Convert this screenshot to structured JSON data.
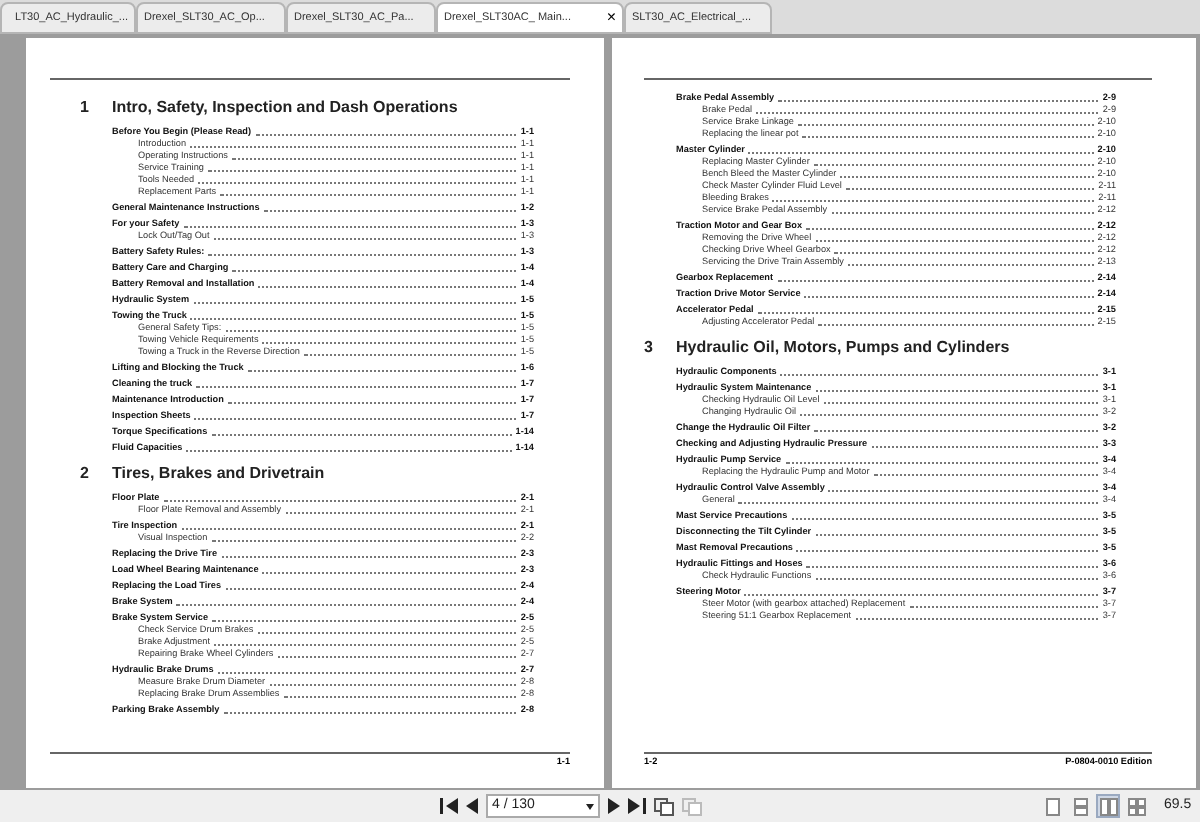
{
  "tabs": [
    {
      "label": "LT30_AC_Hydraulic_...",
      "selected": false
    },
    {
      "label": "Drexel_SLT30_AC_Op...",
      "selected": false
    },
    {
      "label": "Drexel_SLT30_AC_Pa...",
      "selected": false
    },
    {
      "label": "Drexel_SLT30AC_ Main...",
      "selected": true,
      "close": "×"
    },
    {
      "label": "SLT30_AC_Electrical_...",
      "selected": false
    }
  ],
  "pages": [
    {
      "footer_right": "1-1",
      "entries": [
        {
          "kind": "chapter",
          "number": "1",
          "title": "Intro, Safety, Inspection and Dash Operations"
        },
        {
          "kind": "section",
          "title": "Before You Begin (Please Read)",
          "page": "1-1",
          "children": [
            {
              "title": "Introduction",
              "page": "1-1"
            },
            {
              "title": "Operating Instructions",
              "page": "1-1"
            },
            {
              "title": "Service Training",
              "page": "1-1"
            },
            {
              "title": "Tools Needed",
              "page": "1-1"
            },
            {
              "title": "Replacement Parts",
              "page": "1-1"
            }
          ]
        },
        {
          "kind": "section",
          "title": "General Maintenance Instructions",
          "page": "1-2"
        },
        {
          "kind": "section",
          "title": "For your Safety",
          "page": "1-3",
          "children": [
            {
              "title": "Lock Out/Tag Out",
              "page": "1-3"
            }
          ]
        },
        {
          "kind": "section",
          "title": "Battery Safety Rules:",
          "page": "1-3"
        },
        {
          "kind": "section",
          "title": "Battery Care and Charging",
          "page": "1-4"
        },
        {
          "kind": "section",
          "title": "Battery Removal and Installation",
          "page": "1-4"
        },
        {
          "kind": "section",
          "title": "Hydraulic System",
          "page": "1-5"
        },
        {
          "kind": "section",
          "title": "Towing the Truck",
          "page": "1-5",
          "children": [
            {
              "title": "General Safety Tips:",
              "page": "1-5"
            },
            {
              "title": "Towing Vehicle Requirements",
              "page": "1-5"
            },
            {
              "title": "Towing a Truck in the Reverse Direction",
              "page": "1-5"
            }
          ]
        },
        {
          "kind": "section",
          "title": "Lifting and Blocking the Truck",
          "page": "1-6"
        },
        {
          "kind": "section",
          "title": "Cleaning the truck",
          "page": "1-7"
        },
        {
          "kind": "section",
          "title": "Maintenance Introduction",
          "page": "1-7"
        },
        {
          "kind": "section",
          "title": "Inspection Sheets",
          "page": "1-7"
        },
        {
          "kind": "section",
          "title": "Torque Specifications",
          "page": "1-14"
        },
        {
          "kind": "section",
          "title": "Fluid Capacities",
          "page": "1-14"
        },
        {
          "kind": "chapter",
          "number": "2",
          "title": "Tires, Brakes and Drivetrain"
        },
        {
          "kind": "section",
          "title": "Floor Plate",
          "page": "2-1",
          "children": [
            {
              "title": "Floor Plate Removal and Assembly",
              "page": "2-1"
            }
          ]
        },
        {
          "kind": "section",
          "title": "Tire Inspection",
          "page": "2-1",
          "children": [
            {
              "title": "Visual Inspection",
              "page": "2-2"
            }
          ]
        },
        {
          "kind": "section",
          "title": "Replacing the Drive Tire",
          "page": "2-3"
        },
        {
          "kind": "section",
          "title": "Load Wheel Bearing Maintenance",
          "page": "2-3"
        },
        {
          "kind": "section",
          "title": "Replacing the Load Tires",
          "page": "2-4"
        },
        {
          "kind": "section",
          "title": "Brake System",
          "page": "2-4"
        },
        {
          "kind": "section",
          "title": "Brake System Service",
          "page": "2-5",
          "children": [
            {
              "title": "Check Service Drum Brakes",
              "page": "2-5"
            },
            {
              "title": "Brake Adjustment",
              "page": "2-5"
            },
            {
              "title": "Repairing Brake Wheel Cylinders",
              "page": "2-7"
            }
          ]
        },
        {
          "kind": "section",
          "title": "Hydraulic Brake Drums",
          "page": "2-7",
          "children": [
            {
              "title": "Measure Brake Drum Diameter",
              "page": "2-8"
            },
            {
              "title": "Replacing Brake Drum Assemblies",
              "page": "2-8"
            }
          ]
        },
        {
          "kind": "section",
          "title": "Parking Brake Assembly",
          "page": "2-8"
        }
      ]
    },
    {
      "footer_left": "1-2",
      "footer_right": "P-0804-0010 Edition",
      "entries": [
        {
          "kind": "section",
          "title": "Brake Pedal Assembly",
          "page": "2-9",
          "children": [
            {
              "title": "Brake Pedal",
              "page": "2-9"
            },
            {
              "title": "Service Brake Linkage",
              "page": "2-10"
            },
            {
              "title": "Replacing the linear pot",
              "page": "2-10"
            }
          ]
        },
        {
          "kind": "section",
          "title": "Master Cylinder",
          "page": "2-10",
          "children": [
            {
              "title": "Replacing Master Cylinder",
              "page": "2-10"
            },
            {
              "title": "Bench Bleed the Master Cylinder",
              "page": "2-10"
            },
            {
              "title": "Check Master Cylinder Fluid Level",
              "page": "2-11"
            },
            {
              "title": "Bleeding Brakes",
              "page": "2-11"
            },
            {
              "title": "Service Brake Pedal Assembly",
              "page": "2-12"
            }
          ]
        },
        {
          "kind": "section",
          "title": "Traction Motor and Gear Box",
          "page": "2-12",
          "children": [
            {
              "title": "Removing the Drive Wheel",
              "page": "2-12"
            },
            {
              "title": "Checking Drive Wheel Gearbox",
              "page": "2-12"
            },
            {
              "title": "Servicing the Drive Train Assembly",
              "page": "2-13"
            }
          ]
        },
        {
          "kind": "section",
          "title": "Gearbox Replacement",
          "page": "2-14"
        },
        {
          "kind": "section",
          "title": "Traction Drive Motor Service",
          "page": "2-14"
        },
        {
          "kind": "section",
          "title": "Accelerator Pedal",
          "page": "2-15",
          "children": [
            {
              "title": "Adjusting Accelerator Pedal",
              "page": "2-15"
            }
          ]
        },
        {
          "kind": "chapter",
          "number": "3",
          "title": "Hydraulic Oil, Motors, Pumps and Cylinders"
        },
        {
          "kind": "section",
          "title": "Hydraulic Components",
          "page": "3-1"
        },
        {
          "kind": "section",
          "title": "Hydraulic System Maintenance",
          "page": "3-1",
          "children": [
            {
              "title": "Checking Hydraulic Oil Level",
              "page": "3-1"
            },
            {
              "title": "Changing Hydraulic Oil",
              "page": "3-2"
            }
          ]
        },
        {
          "kind": "section",
          "title": "Change the Hydraulic Oil Filter",
          "page": "3-2"
        },
        {
          "kind": "section",
          "title": "Checking and Adjusting Hydraulic Pressure",
          "page": "3-3"
        },
        {
          "kind": "section",
          "title": "Hydraulic Pump Service",
          "page": "3-4",
          "children": [
            {
              "title": "Replacing the Hydraulic Pump and Motor",
              "page": "3-4"
            }
          ]
        },
        {
          "kind": "section",
          "title": "Hydraulic Control Valve Assembly",
          "page": "3-4",
          "children": [
            {
              "title": "General",
              "page": "3-4"
            }
          ]
        },
        {
          "kind": "section",
          "title": "Mast Service Precautions",
          "page": "3-5"
        },
        {
          "kind": "section",
          "title": "Disconnecting the Tilt Cylinder",
          "page": "3-5"
        },
        {
          "kind": "section",
          "title": "Mast Removal Precautions",
          "page": "3-5"
        },
        {
          "kind": "section",
          "title": "Hydraulic Fittings and Hoses",
          "page": "3-6",
          "children": [
            {
              "title": "Check Hydraulic Functions",
              "page": "3-6"
            }
          ]
        },
        {
          "kind": "section",
          "title": "Steering Motor",
          "page": "3-7",
          "children": [
            {
              "title": "Steer Motor (with gearbox attached) Replacement",
              "page": "3-7"
            },
            {
              "title": "Steering 51:1 Gearbox Replacement",
              "page": "3-7"
            }
          ]
        }
      ]
    }
  ],
  "toolbar": {
    "page_field": "4 / 130",
    "view_modes": [
      {
        "selected": false
      },
      {
        "selected": false
      },
      {
        "selected": true
      },
      {
        "selected": false
      }
    ],
    "zoom": "69.5"
  }
}
